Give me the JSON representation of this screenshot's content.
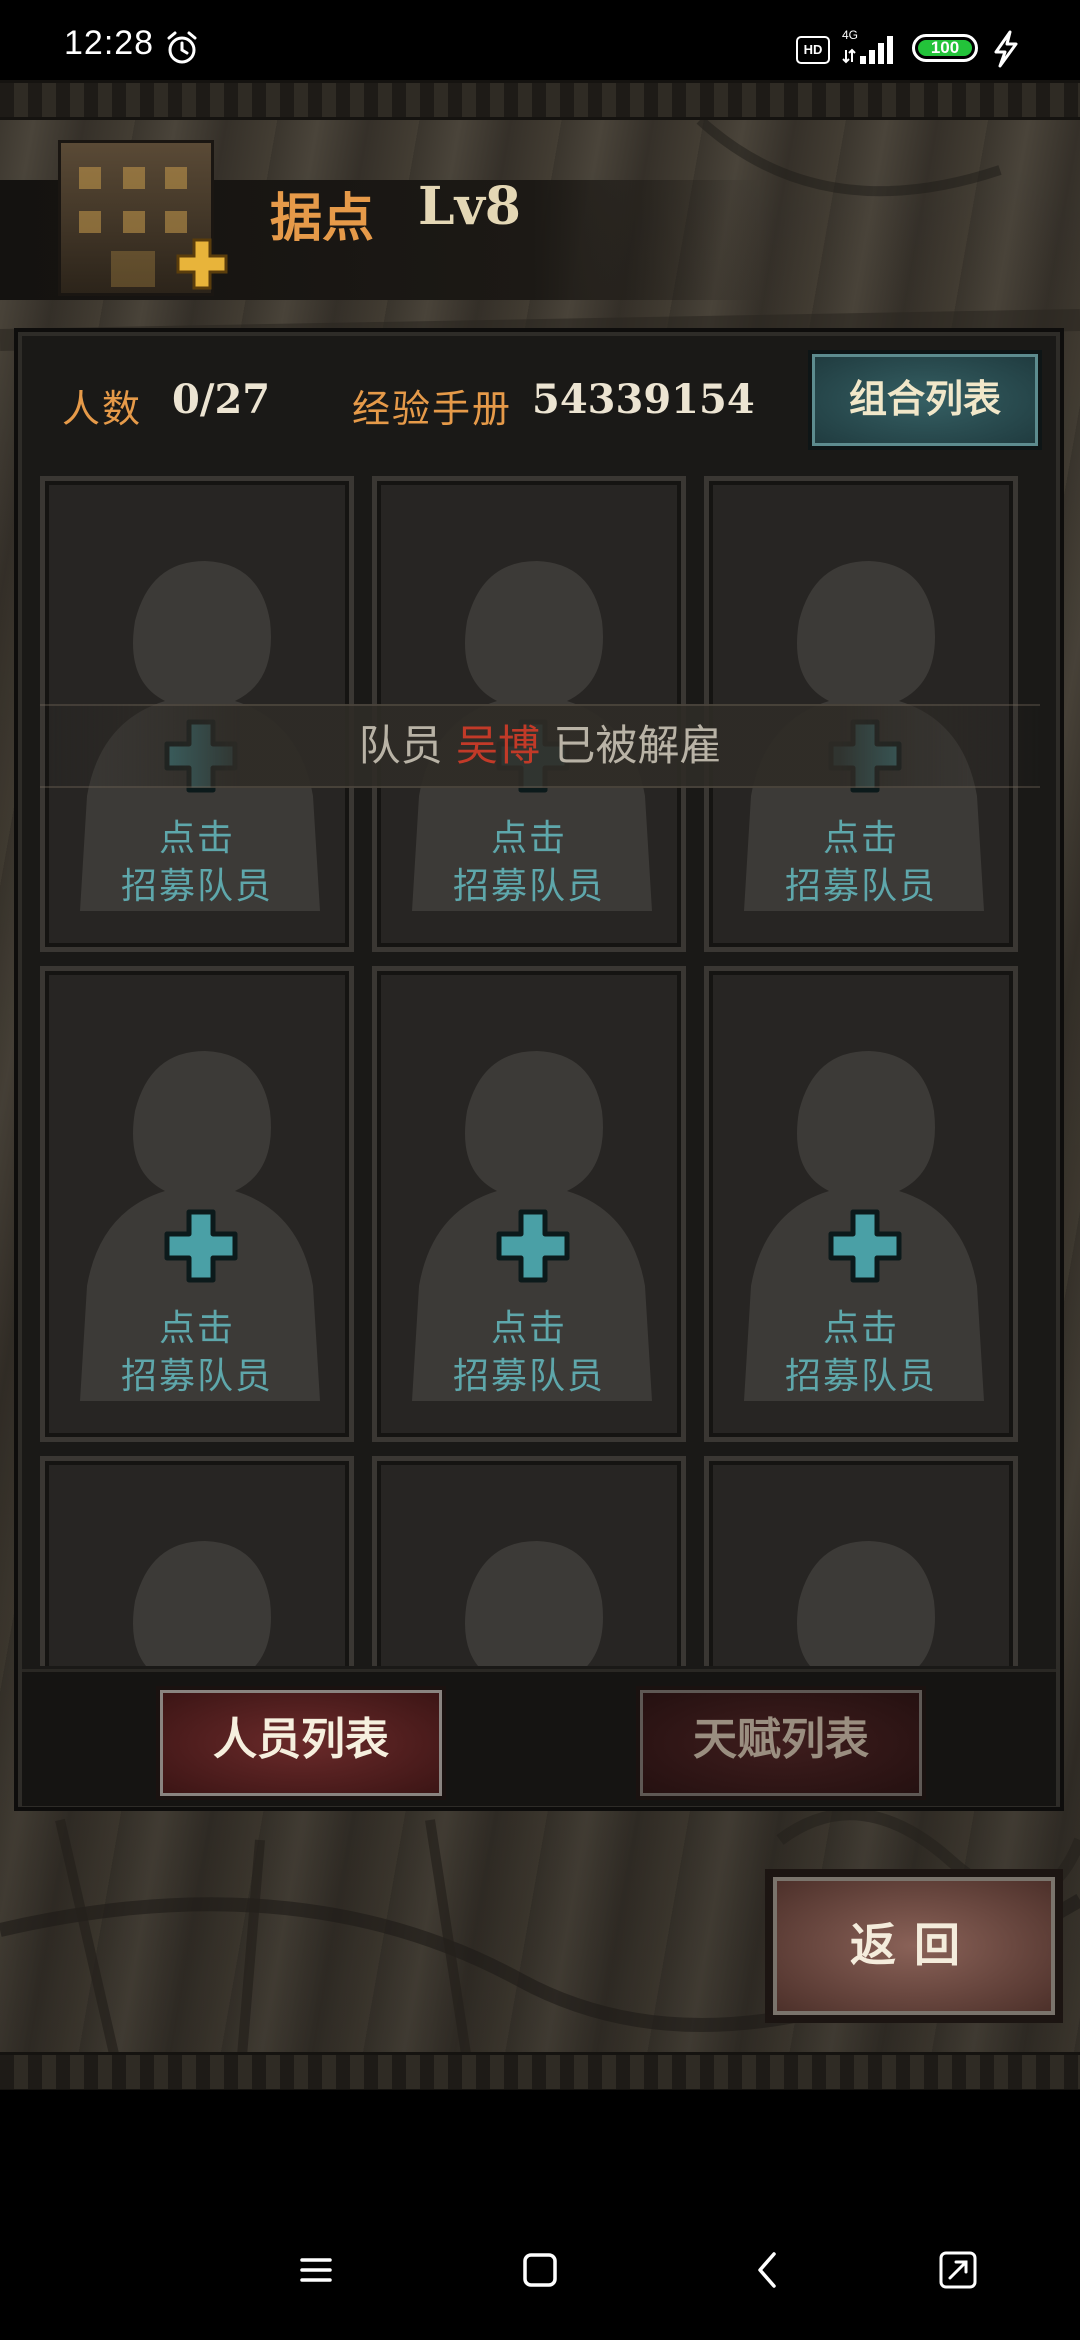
{
  "status_bar": {
    "time": "12:28",
    "hd": "HD",
    "network": "4G",
    "battery": "100",
    "battery_color": "#23c33a"
  },
  "header": {
    "title": "据点",
    "level": "Lv8",
    "title_color": "#e69a49"
  },
  "stats": {
    "members_label": "人数",
    "members_value": "0/27",
    "exp_label": "经验手册",
    "exp_value": "54339154",
    "combo_button": "组合列表"
  },
  "notice": {
    "prefix": "队员",
    "name": "吴博",
    "suffix": "已被解雇",
    "name_color": "#c23a28"
  },
  "cards": [
    {
      "line1": "点击",
      "line2": "招募队员"
    },
    {
      "line1": "点击",
      "line2": "招募队员"
    },
    {
      "line1": "点击",
      "line2": "招募队员"
    },
    {
      "line1": "点击",
      "line2": "招募队员"
    },
    {
      "line1": "点击",
      "line2": "招募队员"
    },
    {
      "line1": "点击",
      "line2": "招募队员"
    },
    {
      "line1": "",
      "line2": ""
    },
    {
      "line1": "",
      "line2": ""
    },
    {
      "line1": "",
      "line2": ""
    }
  ],
  "tabs": {
    "personnel": "人员列表",
    "talent": "天赋列表",
    "active": "personnel"
  },
  "back_button": "返回",
  "nav_icons": [
    "menu-icon",
    "home-icon",
    "back-icon",
    "screenshot-icon"
  ]
}
